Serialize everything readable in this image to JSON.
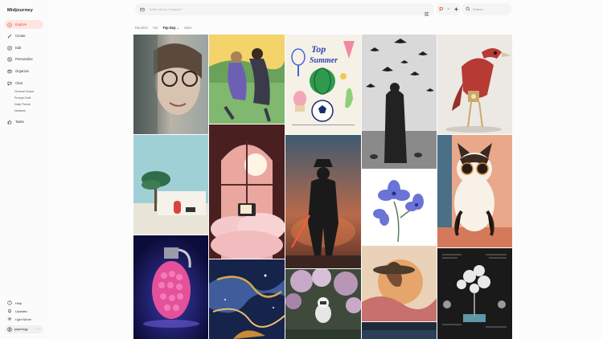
{
  "app": {
    "logo": "Midjourney"
  },
  "sidebar": {
    "items": [
      {
        "label": "Explore",
        "icon": "compass-icon"
      },
      {
        "label": "Create",
        "icon": "brush-icon"
      },
      {
        "label": "Edit",
        "icon": "edit-icon"
      },
      {
        "label": "Personalize",
        "icon": "sliders-icon"
      },
      {
        "label": "Organize",
        "icon": "folder-icon"
      },
      {
        "label": "Chat",
        "icon": "chat-icon"
      },
      {
        "label": "Tasks",
        "icon": "thumbs-up-icon"
      }
    ],
    "chat_channels": [
      "General Chaos",
      "Prompt Craft",
      "Daily Theme",
      "Newbies"
    ],
    "bottom": [
      {
        "label": "Help",
        "icon": "help-icon"
      },
      {
        "label": "Updates",
        "icon": "bell-icon"
      },
      {
        "label": "Light Mode",
        "icon": "sun-icon"
      }
    ],
    "user": {
      "name": "paperlogy",
      "menu": "···"
    }
  },
  "topbar": {
    "prompt_placeholder": "What will you imagine?",
    "search_placeholder": "Search"
  },
  "tabs": [
    {
      "label": "Random"
    },
    {
      "label": "Hot"
    },
    {
      "label": "Top Day"
    },
    {
      "label": "Likes"
    }
  ],
  "gallery": {
    "poster_title_1": "Top",
    "poster_title_2": "Summer"
  }
}
